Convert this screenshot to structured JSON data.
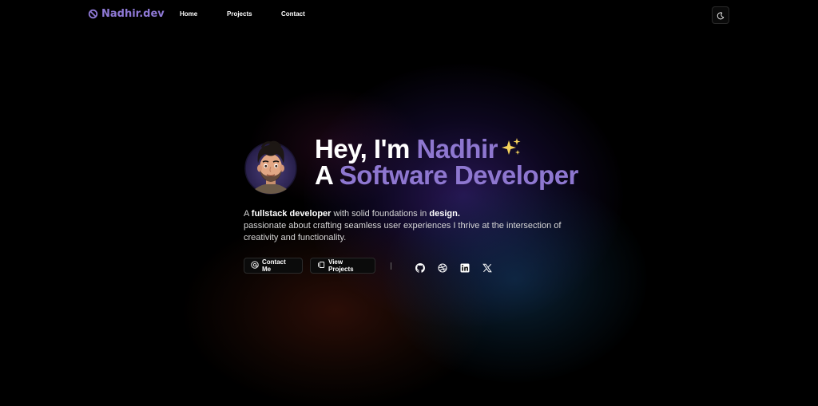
{
  "brand": {
    "name": "Nadhir.dev",
    "color": "#8f79d6"
  },
  "nav": {
    "links": [
      "Home",
      "Projects",
      "Contact"
    ],
    "theme_toggle_icon": "moon-icon"
  },
  "hero": {
    "heading_line1_prefix": "Hey, I'm ",
    "heading_line1_name": "Nadhir",
    "heading_line2_prefix": "A ",
    "heading_line2_role": "Software Developer",
    "accent_color": "#8e77d0",
    "desc_line1_a": "A ",
    "desc_line1_b": "fullstack developer",
    "desc_line1_c": " with solid foundations in ",
    "desc_line1_d": "design.",
    "desc_line2": "passionate about crafting seamless user experiences I thrive at the intersection of creativity and functionality."
  },
  "actions": {
    "contact_label": "Contact Me",
    "projects_label": "View Projects"
  },
  "social": [
    "github-icon",
    "dribbble-icon",
    "linkedin-icon",
    "x-icon"
  ]
}
